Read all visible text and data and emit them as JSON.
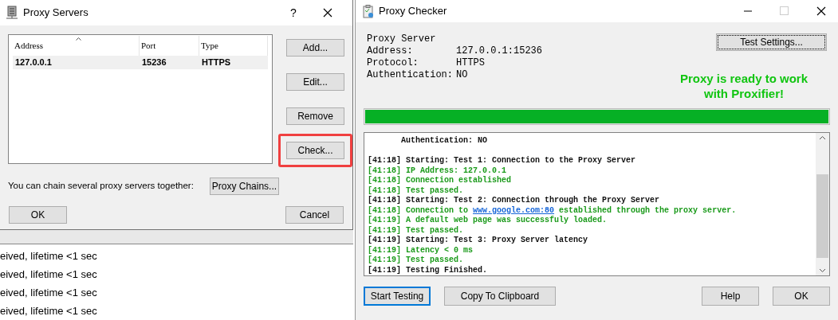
{
  "proxy_servers_dialog": {
    "title": "Proxy Servers",
    "help_button": "?",
    "table": {
      "columns": [
        {
          "label": "Address",
          "sorted": true
        },
        {
          "label": "Port",
          "sorted": false
        },
        {
          "label": "Type",
          "sorted": false
        }
      ],
      "rows": [
        {
          "cells": [
            "127.0.0.1",
            "15236",
            "HTTPS"
          ],
          "selected": true
        }
      ]
    },
    "side_buttons": [
      {
        "label": "Add...",
        "highlighted": false
      },
      {
        "label": "Edit...",
        "highlighted": false
      },
      {
        "label": "Remove",
        "highlighted": false
      },
      {
        "label": "Check...",
        "highlighted": true
      }
    ],
    "chain_text": "You can chain several proxy servers together:",
    "chain_button": "Proxy Chains...",
    "ok_button": "OK",
    "cancel_button": "Cancel"
  },
  "background_log": [
    "eived, lifetime <1 sec",
    "eived, lifetime <1 sec",
    "eived, lifetime <1 sec",
    "eived, lifetime <1 sec"
  ],
  "proxy_checker": {
    "title": "Proxy Checker",
    "info": [
      {
        "label": "Proxy Server"
      },
      {
        "label": "Address:",
        "value": "127.0.0.1:15236"
      },
      {
        "label": "Protocol:",
        "value": "HTTPS"
      },
      {
        "label": "Authentication:",
        "value": "NO"
      }
    ],
    "test_settings_button": "Test Settings...",
    "status_message": "Proxy is ready to work with Proxifier!",
    "progress": {
      "level": 1
    },
    "log": [
      {
        "kind": "header",
        "text": "       Authentication: NO"
      },
      {
        "kind": "blank"
      },
      {
        "kind": "header",
        "time": "[41:18]",
        "text": "Starting: Test 1: Connection to the Proxy Server"
      },
      {
        "kind": "info",
        "time": "[41:18]",
        "text": "IP Address: 127.0.0.1"
      },
      {
        "kind": "info",
        "time": "[41:18]",
        "text": "Connection established"
      },
      {
        "kind": "info",
        "time": "[41:18]",
        "text": "Test passed."
      },
      {
        "kind": "header",
        "time": "[41:18]",
        "text": "Starting: Test 2: Connection through the Proxy Server"
      },
      {
        "kind": "info",
        "time": "[41:18]",
        "text": "Connection to",
        "link": "www.google.com:80",
        "after": "established through the proxy server."
      },
      {
        "kind": "info",
        "time": "[41:19]",
        "text": "A default web page was successfuly loaded."
      },
      {
        "kind": "info",
        "time": "[41:19]",
        "text": "Test passed."
      },
      {
        "kind": "header",
        "time": "[41:19]",
        "text": "Starting: Test 3: Proxy Server latency"
      },
      {
        "kind": "info",
        "time": "[41:19]",
        "text": "Latency < 0 ms"
      },
      {
        "kind": "info",
        "time": "[41:19]",
        "text": "Test passed."
      },
      {
        "kind": "header",
        "time": "[41:19]",
        "text": "Testing Finished."
      }
    ],
    "buttons": [
      {
        "label": "Start Testing",
        "focused": true
      },
      {
        "label": "Copy To Clipboard",
        "focused": false
      },
      {
        "label": "Help",
        "focused": false
      },
      {
        "label": "OK",
        "focused": false
      }
    ]
  }
}
